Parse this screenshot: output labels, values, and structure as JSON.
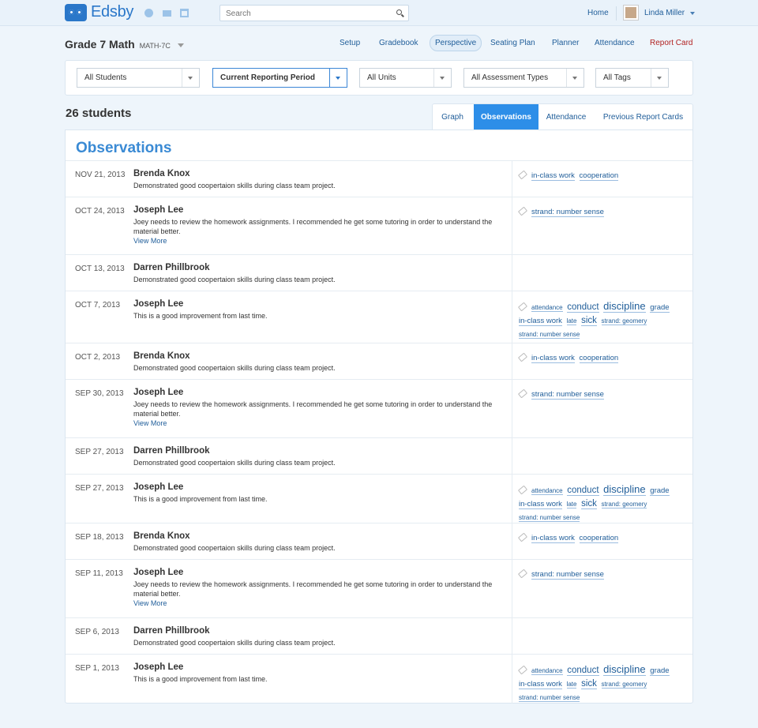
{
  "topbar": {
    "brand": "Edsby",
    "search_placeholder": "Search",
    "home_label": "Home",
    "user_name": "Linda Miller"
  },
  "course": {
    "title": "Grade 7 Math",
    "code": "MATH-7C"
  },
  "nav": {
    "items": [
      {
        "label": "Setup"
      },
      {
        "label": "Gradebook"
      },
      {
        "label": "Perspective",
        "active": true
      },
      {
        "label": "Seating Plan"
      },
      {
        "label": "Planner"
      },
      {
        "label": "Attendance"
      },
      {
        "label": "Report Card"
      }
    ]
  },
  "filters": [
    {
      "value": "All Students"
    },
    {
      "value": "Current Reporting Period"
    },
    {
      "value": "All Units"
    },
    {
      "value": "All Assessment Types"
    },
    {
      "value": "All Tags"
    }
  ],
  "count_label": "26 students",
  "tabs": [
    {
      "label": "Graph"
    },
    {
      "label": "Observations",
      "active": true
    },
    {
      "label": "Attendance"
    },
    {
      "label": "Previous Report Cards"
    }
  ],
  "panel_title": "Observations",
  "colors": {
    "accent": "#2d8ee8",
    "title": "#3a8ad4",
    "link": "#1f5d99",
    "report_card": "#b22222"
  },
  "observations": [
    {
      "date": "NOV 21, 2013",
      "name": "Brenda Knox",
      "text": "Demonstrated good coopertaion skills during class team project.",
      "view_more": "",
      "tags": [
        "in-class work",
        "cooperation"
      ]
    },
    {
      "date": "OCT 24, 2013",
      "name": "Joseph Lee",
      "text": "Joey needs to review the homework assignments. I recommended he get some tutoring in order to understand the material better.",
      "view_more": "View More",
      "tags": [
        "strand: number sense"
      ]
    },
    {
      "date": "OCT 13, 2013",
      "name": "Darren Phillbrook",
      "text": "Demonstrated good coopertaion skills during class team project.",
      "view_more": "",
      "tags": []
    },
    {
      "date": "OCT 7, 2013",
      "name": "Joseph Lee",
      "text": "This is a good improvement from last time.",
      "view_more": "",
      "tags": [
        "attendance",
        "conduct",
        "discipline",
        "grade",
        "in-class work",
        "late",
        "sick",
        "strand: geomery",
        "strand: number sense"
      ]
    },
    {
      "date": "OCT 2, 2013",
      "name": "Brenda Knox",
      "text": "Demonstrated good coopertaion skills during class team project.",
      "view_more": "",
      "tags": [
        "in-class work",
        "cooperation"
      ]
    },
    {
      "date": "SEP 30, 2013",
      "name": "Joseph Lee",
      "text": "Joey needs to review the homework assignments. I recommended he get some tutoring in order to understand the material better.",
      "view_more": "View More",
      "tags": [
        "strand: number sense"
      ]
    },
    {
      "date": "SEP 27, 2013",
      "name": "Darren Phillbrook",
      "text": "Demonstrated good coopertaion skills during class team project.",
      "view_more": "",
      "tags": []
    },
    {
      "date": "SEP 27, 2013",
      "name": "Joseph Lee",
      "text": "This is a good improvement from last time.",
      "view_more": "",
      "tags": [
        "attendance",
        "conduct",
        "discipline",
        "grade",
        "in-class work",
        "late",
        "sick",
        "strand: geomery",
        "strand: number sense"
      ]
    },
    {
      "date": "SEP 18, 2013",
      "name": "Brenda Knox",
      "text": "Demonstrated good coopertaion skills during class team project.",
      "view_more": "",
      "tags": [
        "in-class work",
        "cooperation"
      ]
    },
    {
      "date": "SEP 11, 2013",
      "name": "Joseph Lee",
      "text": "Joey needs to review the homework assignments. I recommended he get some tutoring in order to understand the material better.",
      "view_more": "View More",
      "tags": [
        "strand: number sense"
      ]
    },
    {
      "date": "SEP 6, 2013",
      "name": "Darren Phillbrook",
      "text": "Demonstrated good coopertaion skills during class team project.",
      "view_more": "",
      "tags": []
    },
    {
      "date": "SEP 1, 2013",
      "name": "Joseph Lee",
      "text": "This is a good improvement from last time.",
      "view_more": "",
      "tags": [
        "attendance",
        "conduct",
        "discipline",
        "grade",
        "in-class work",
        "late",
        "sick",
        "strand: geomery",
        "strand: number sense"
      ]
    }
  ]
}
